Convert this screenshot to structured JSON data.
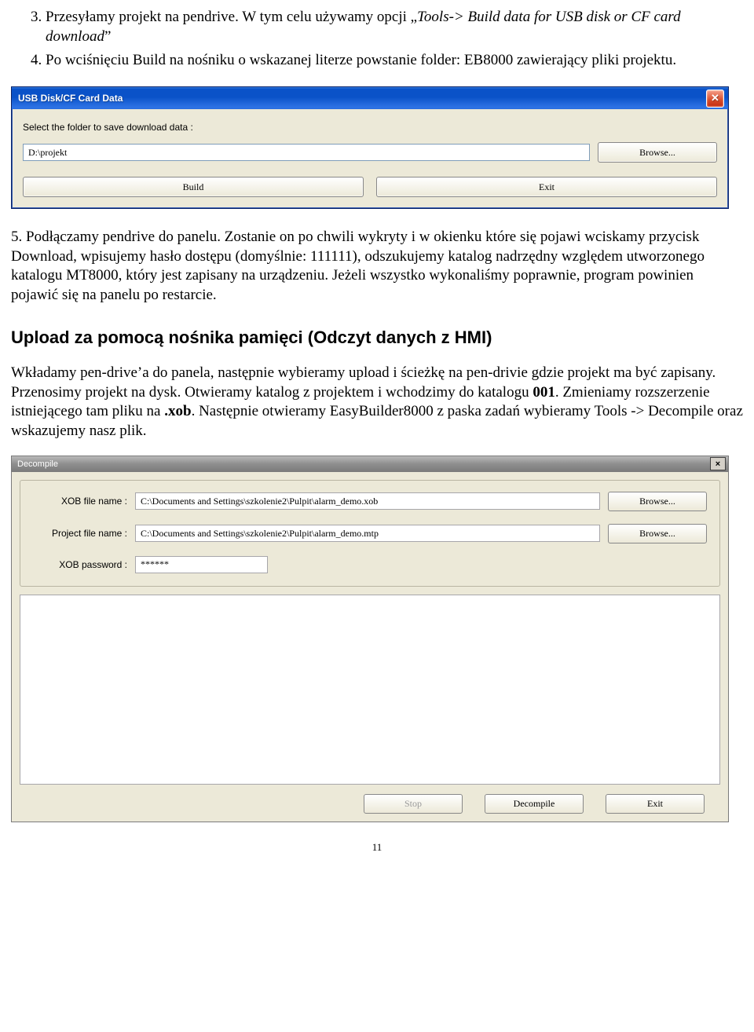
{
  "list": {
    "item3_prefix": "Przesyłamy projekt na pendrive. W tym celu używamy opcji „",
    "item3_italic": "Tools-> Build data for USB disk or CF card download",
    "item3_suffix": "”",
    "item4": "Po wciśnięciu Build na nośniku o wskazanej literze powstanie folder: EB8000 zawierający pliki projektu."
  },
  "dialog1": {
    "title": "USB Disk/CF Card Data",
    "prompt": "Select the folder to save download data  :",
    "path": "D:\\projekt",
    "browse": "Browse...",
    "build": "Build",
    "exit": "Exit"
  },
  "para5": "5.   Podłączamy pendrive do panelu. Zostanie on po chwili wykryty i w okienku które się pojawi wciskamy przycisk Download, wpisujemy hasło dostępu (domyślnie: 111111), odszukujemy katalog nadrzędny względem utworzonego katalogu MT8000, który jest zapisany na urządzeniu. Jeżeli wszystko wykonaliśmy poprawnie, program powinien pojawić się na panelu po restarcie.",
  "heading_upload": "Upload za pomocą nośnika pamięci (Odczyt danych z HMI)",
  "para_upload_a": "Wkładamy pen-drive’a do panela, następnie wybieramy upload i ścieżkę na pen-drivie gdzie projekt ma być zapisany. Przenosimy projekt na dysk. Otwieramy katalog z projektem i wchodzimy do katalogu ",
  "para_upload_bold1": "001",
  "para_upload_b": ". Zmieniamy rozszerzenie istniejącego tam pliku na ",
  "para_upload_bold2": ".xob",
  "para_upload_c": ". Następnie otwieramy EasyBuilder8000 z paska zadań wybieramy Tools -> Decompile oraz wskazujemy nasz plik.",
  "dialog2": {
    "title": "Decompile",
    "labels": {
      "xob": "XOB file name :",
      "project": "Project file name :",
      "password": "XOB password :"
    },
    "values": {
      "xob": "C:\\Documents and Settings\\szkolenie2\\Pulpit\\alarm_demo.xob",
      "project": "C:\\Documents and Settings\\szkolenie2\\Pulpit\\alarm_demo.mtp",
      "password": "******"
    },
    "browse": "Browse...",
    "stop": "Stop",
    "decompile": "Decompile",
    "exit": "Exit"
  },
  "page_number": "11"
}
